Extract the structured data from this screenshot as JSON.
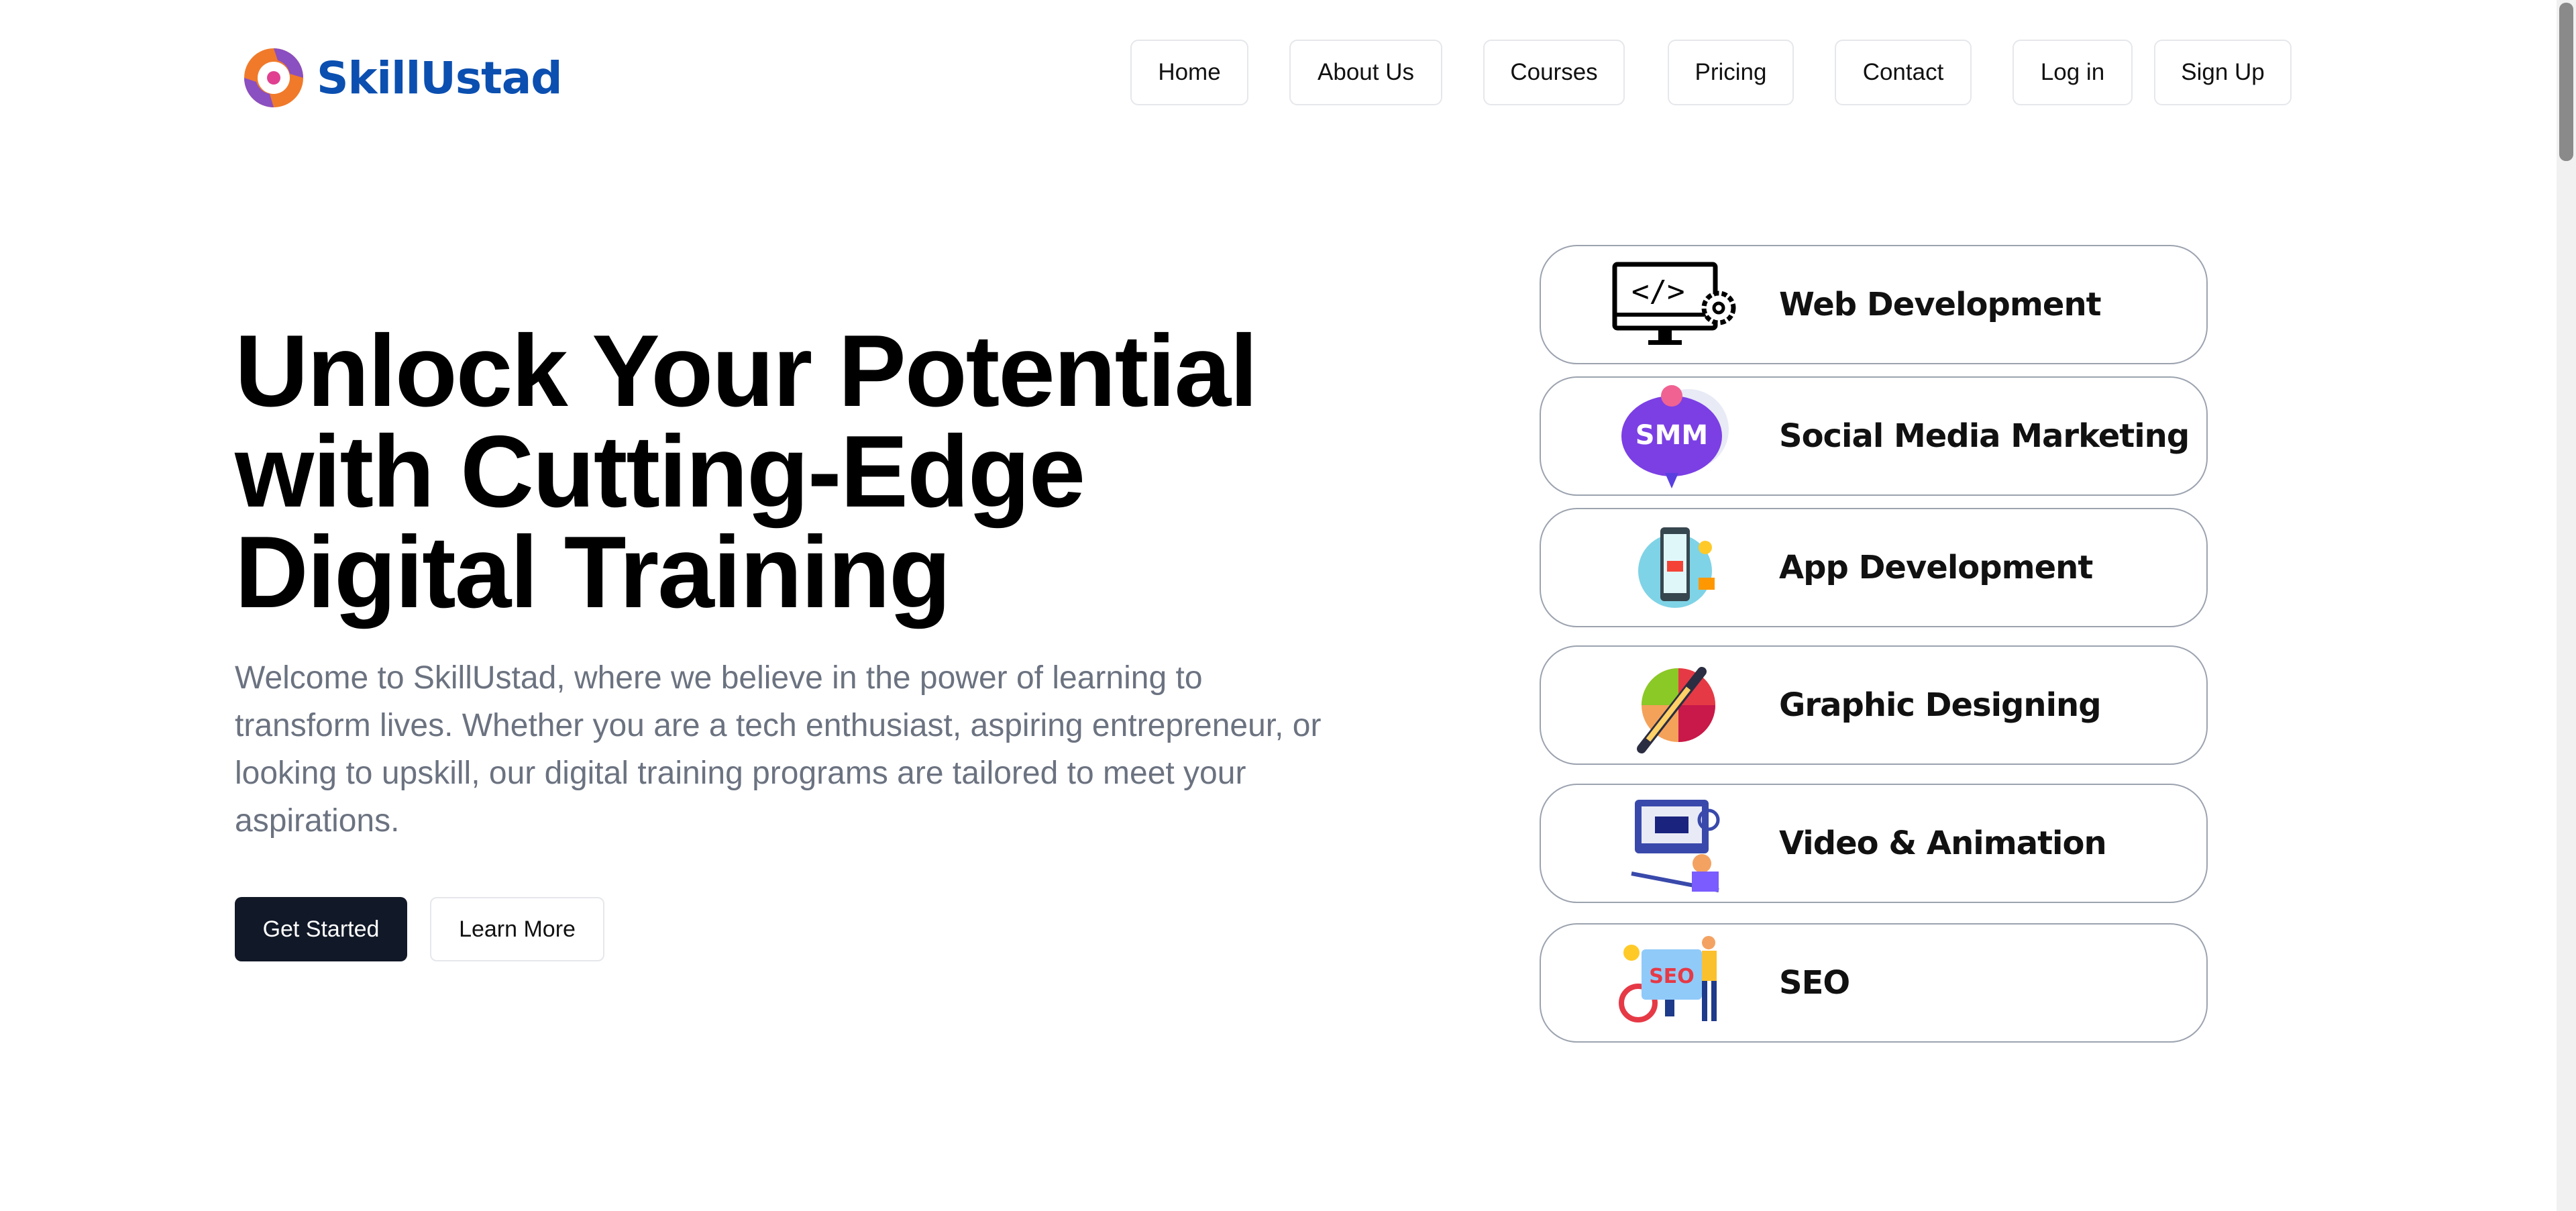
{
  "brand": {
    "name": "SkillUstad",
    "color": "#0b4fb0"
  },
  "nav": {
    "items": [
      "Home",
      "About Us",
      "Courses",
      "Pricing",
      "Contact"
    ],
    "login": "Log in",
    "signup": "Sign Up"
  },
  "hero": {
    "title": "Unlock Your Potential with Cutting-Edge Digital Training",
    "description": "Welcome to SkillUstad, where we believe in the power of learning to transform lives. Whether you are a tech enthusiast, aspiring entrepreneur, or looking to upskill, our digital training programs are tailored to meet your aspirations.",
    "primary_button": "Get Started",
    "secondary_button": "Learn More"
  },
  "courses": [
    {
      "label": "Web Development",
      "icon": "monitor-code-gear-icon"
    },
    {
      "label": "Social Media Marketing",
      "icon": "smm-bubble-icon"
    },
    {
      "label": "App Development",
      "icon": "mobile-app-icon"
    },
    {
      "label": "Graphic Designing",
      "icon": "color-wheel-pen-icon"
    },
    {
      "label": "Video & Animation",
      "icon": "video-editing-icon"
    },
    {
      "label": "SEO",
      "icon": "seo-icon"
    }
  ]
}
